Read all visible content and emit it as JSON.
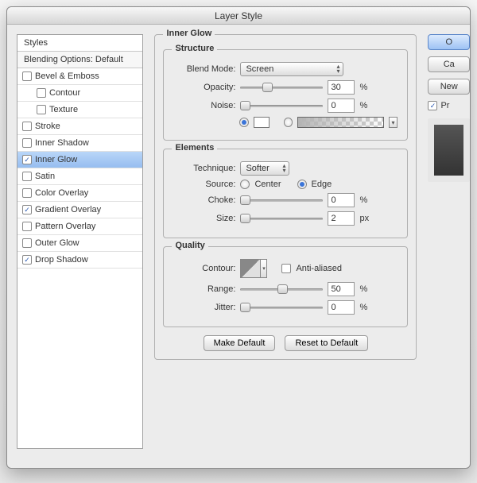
{
  "title": "Layer Style",
  "sidebar": {
    "header": "Styles",
    "sub": "Blending Options: Default",
    "items": [
      {
        "label": "Bevel & Emboss",
        "checked": false
      },
      {
        "label": "Contour",
        "checked": false,
        "indent": true
      },
      {
        "label": "Texture",
        "checked": false,
        "indent": true
      },
      {
        "label": "Stroke",
        "checked": false
      },
      {
        "label": "Inner Shadow",
        "checked": false
      },
      {
        "label": "Inner Glow",
        "checked": true,
        "selected": true
      },
      {
        "label": "Satin",
        "checked": false
      },
      {
        "label": "Color Overlay",
        "checked": false
      },
      {
        "label": "Gradient Overlay",
        "checked": true
      },
      {
        "label": "Pattern Overlay",
        "checked": false
      },
      {
        "label": "Outer Glow",
        "checked": false
      },
      {
        "label": "Drop Shadow",
        "checked": true
      }
    ]
  },
  "panel_title": "Inner Glow",
  "structure": {
    "title": "Structure",
    "blend_mode_label": "Blend Mode:",
    "blend_mode_value": "Screen",
    "opacity_label": "Opacity:",
    "opacity_value": "30",
    "opacity_unit": "%",
    "noise_label": "Noise:",
    "noise_value": "0",
    "noise_unit": "%"
  },
  "elements": {
    "title": "Elements",
    "technique_label": "Technique:",
    "technique_value": "Softer",
    "source_label": "Source:",
    "center_label": "Center",
    "edge_label": "Edge",
    "choke_label": "Choke:",
    "choke_value": "0",
    "choke_unit": "%",
    "size_label": "Size:",
    "size_value": "2",
    "size_unit": "px"
  },
  "quality": {
    "title": "Quality",
    "contour_label": "Contour:",
    "aa_label": "Anti-aliased",
    "range_label": "Range:",
    "range_value": "50",
    "range_unit": "%",
    "jitter_label": "Jitter:",
    "jitter_value": "0",
    "jitter_unit": "%"
  },
  "buttons": {
    "make_default": "Make Default",
    "reset_default": "Reset to Default"
  },
  "right": {
    "ok": "O",
    "cancel": "Ca",
    "new_style": "New ",
    "preview": "Pr"
  }
}
